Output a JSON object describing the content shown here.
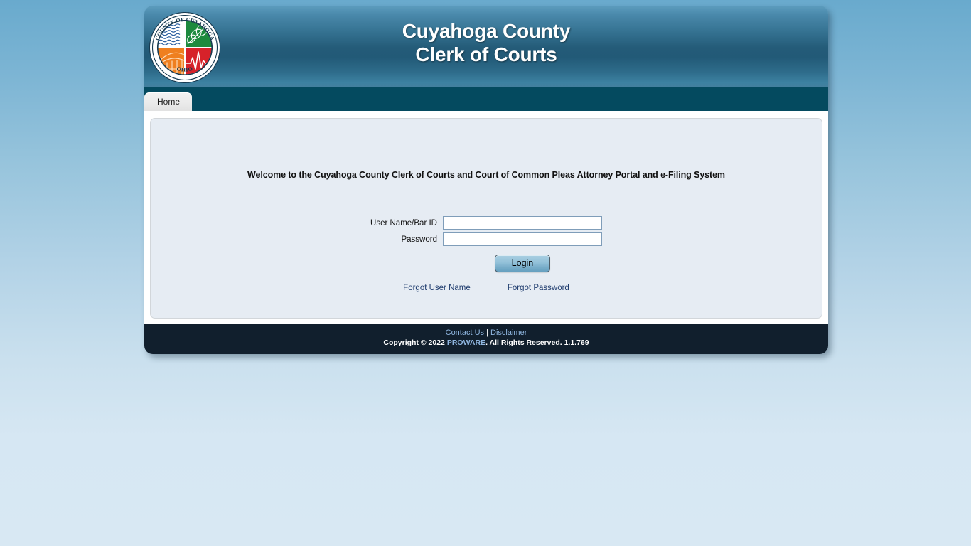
{
  "header": {
    "title_line1": "Cuyahoga County",
    "title_line2": "Clerk of Courts",
    "seal": {
      "top_text": "COUNTY OF CUYAHOGA",
      "bottom_text": "OHIO",
      "colors": {
        "waves": "#2a5fa0",
        "leaf": "#1d8a3e",
        "bridge": "#ef7f1f",
        "heartbeat": "#d6222a"
      }
    }
  },
  "nav": {
    "tabs": [
      {
        "label": "Home",
        "active": true
      }
    ]
  },
  "main": {
    "welcome": "Welcome to the Cuyahoga County Clerk of Courts and Court of Common Pleas Attorney Portal and e-Filing System",
    "form": {
      "username_label": "User Name/Bar ID",
      "username_value": "",
      "username_placeholder": "",
      "password_label": "Password",
      "password_value": "",
      "password_placeholder": "",
      "login_button": "Login",
      "forgot_username_link": "Forgot User Name",
      "forgot_password_link": "Forgot Password"
    }
  },
  "footer": {
    "contact_link": "Contact Us",
    "separator": "|",
    "disclaimer_link": "Disclaimer",
    "copyright_prefix": "Copyright © 2022 ",
    "vendor_link": "PROWARE",
    "copyright_suffix": ". All Rights Reserved. 1.1.769"
  },
  "theme": {
    "navbar_color": "#044a5f",
    "footer_color": "#111f2d",
    "panel_color": "#e6ecf3",
    "link_color": "#1f3c6e"
  }
}
